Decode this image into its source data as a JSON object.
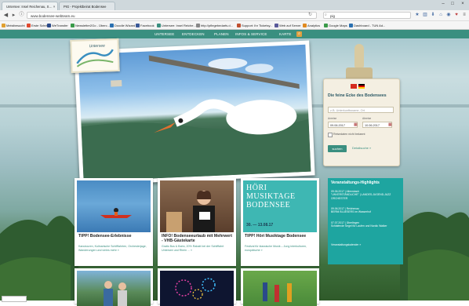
{
  "browser": {
    "tabs": [
      {
        "label": "Untersee: Insel Reichenau, S… ×"
      },
      {
        "label": "PIG - Projektbeirat Bodensee"
      }
    ],
    "url": "www.bodensee-webteam.eu",
    "search_value": "pig",
    "bookmarks": [
      {
        "label": "Meistbesucht",
        "color": "#e0a030"
      },
      {
        "label": "Erste Schritte",
        "color": "#e04a30"
      },
      {
        "label": "WeTransfer",
        "color": "#2b4a8a"
      },
      {
        "label": "Newsletter2Go - Überc...",
        "color": "#3a9a4a"
      },
      {
        "label": "Doodle Wizard",
        "color": "#2a70b0"
      },
      {
        "label": "Facebook",
        "color": "#3b5998"
      },
      {
        "label": "Untersee: Insel Reiche...",
        "color": "#3a8f80"
      },
      {
        "label": "http://pflegebedarfs.d...",
        "color": "#888888"
      },
      {
        "label": "Support: Ihr Ticketsy...",
        "color": "#c05030"
      },
      {
        "label": "Web auf Server",
        "color": "#5a5a9a"
      },
      {
        "label": "Analytics",
        "color": "#e08a20"
      },
      {
        "label": "Google Maps",
        "color": "#3a9a4a"
      },
      {
        "label": "Dashboard - TUN Ad...",
        "color": "#2a70b0"
      }
    ]
  },
  "site": {
    "nav": [
      "UNTERSEE",
      "ENTDECKEN",
      "PLANEN",
      "INFOS & SERVICE",
      "KARTE"
    ],
    "logo_text": "Untersee",
    "colors": {
      "accent": "#3a8f80",
      "teal_box": "#1ea5a0"
    }
  },
  "booking": {
    "title": "Die feine Ecke des Bodensees",
    "location_placeholder": "z.B. Unterkunftsname, Ort",
    "arrival_label": "Anreise",
    "departure_label": "Abreise",
    "arrival": "09.06.2017",
    "departure": "10.06.2017",
    "checkbox_label": "Reisedaten nicht bekannt",
    "submit": "suchen",
    "detail_link": "Detailsuche »"
  },
  "events": {
    "title": "Veranstaltungs-Highlights",
    "items": [
      {
        "text": "09.06.2017 | Allensbach\n\"UNVERSTÄNDLICHE\" | LANDES-JUGEND-JAZZ ORCHESTER"
      },
      {
        "text": "09.06.2017 | Reichenau\nBERNI BLUESERS im Wasserhof"
      },
      {
        "text": "07.07.2017 | Überlingen\nSchlafende Segel für Laufen und Nordic Walker"
      }
    ],
    "more": "Veranstaltungskalender »"
  },
  "cards": [
    {
      "title": "TIPP! Bodensee-Erlebnisse",
      "desc": "Kanutouren, Kulinarische Schifffahrten, Orchesterjage, Wanderungen und vieles mehr »",
      "bg": "#3f7fb8"
    },
    {
      "title": "INFO! Bodenseeurlaub mit Mehrwert - VHB-Gästekarte",
      "desc": "Gratis Bus & Bahn, 20% Rabatt bei der Schifffahrt Untersee und Rhein ... »",
      "bg": "#6b4a36"
    },
    {
      "title": "TIPP! Höri Musiktage Bodensee",
      "desc": "Festival für klassische Musik – Jung interkulturen, europäische »",
      "bg": "#3eb7b3",
      "poster_title": "HÖRI MUSIKTAGE BODENSEE",
      "poster_dates": "30. — 13.08.17"
    }
  ]
}
